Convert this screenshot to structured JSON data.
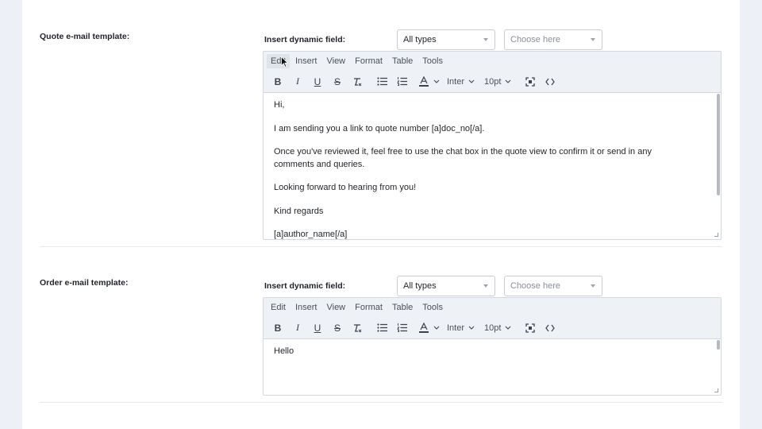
{
  "dynamic_field_label": "Insert dynamic field:",
  "type_select": {
    "value": "All types"
  },
  "field_select": {
    "placeholder": "Choose here"
  },
  "menu": [
    "Edit",
    "Insert",
    "View",
    "Format",
    "Table",
    "Tools"
  ],
  "toolbar": {
    "icons": [
      "bold-icon",
      "italic-icon",
      "underline-icon",
      "strikethrough-icon",
      "clear-format-icon",
      "bullet-list-icon",
      "numbered-list-icon",
      "text-color-icon",
      "fullscreen-icon",
      "source-code-icon"
    ],
    "font_family": "Inter",
    "font_size": "10pt"
  },
  "quote_section": {
    "label": "Quote e-mail template:",
    "body": [
      "Hi,",
      "I am sending you a link to quote number [a]doc_no[/a].",
      "Once you've reviewed it, feel free to use the chat box in the quote view to confirm it or send in any comments and queries.",
      "Looking forward to hearing from you!",
      "Kind regards",
      "[a]author_name[/a]"
    ]
  },
  "order_section": {
    "label": "Order e-mail template:",
    "body": [
      "Hello"
    ]
  },
  "colors": {
    "accent_text": "#1f2328",
    "toolbar_bg": "#eef1f6",
    "page_bg": "#eef0f7"
  }
}
